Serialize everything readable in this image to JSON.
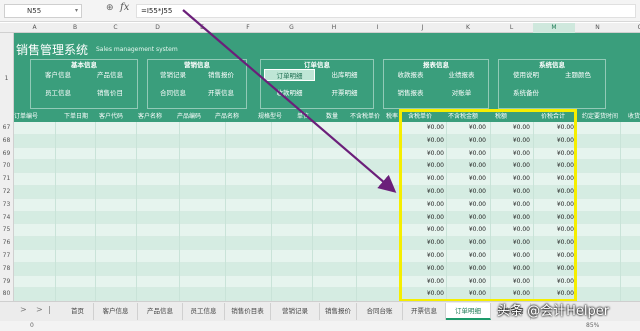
{
  "formula_bar": {
    "name_box": "N55",
    "fx_label": "fx",
    "formula": "=I55*J55"
  },
  "columns": [
    "A",
    "B",
    "C",
    "D",
    "E",
    "F",
    "G",
    "H",
    "I",
    "J",
    "K",
    "L",
    "M",
    "N",
    "O"
  ],
  "banner": {
    "title": "销售管理系统",
    "subtitle": "Sales management system",
    "row_label": "1",
    "groups": [
      {
        "title": "基本信息",
        "buttons": [
          "客户信息",
          "产品信息",
          "员工信息",
          "销售价目"
        ]
      },
      {
        "title": "营销信息",
        "buttons": [
          "营销记录",
          "销售报价",
          "合同信息",
          "开票信息"
        ]
      },
      {
        "title": "订单信息",
        "buttons": [
          "订单明细",
          "出库明细",
          "收款明细",
          "开票明细"
        ]
      },
      {
        "title": "报表信息",
        "buttons": [
          "收款报表",
          "业绩报表",
          "销售报表",
          "对账单"
        ]
      },
      {
        "title": "系统信息",
        "buttons": [
          "使用说明",
          "主题颜色",
          "系统备份"
        ]
      }
    ]
  },
  "table_header": [
    "订单编号",
    "下单日期",
    "客户代码",
    "客户名称",
    "产品编码",
    "产品名称",
    "规格型号",
    "单位",
    "数量",
    "不含税单价",
    "税率",
    "含税单价",
    "不含税金额",
    "税额",
    "价税合计",
    "约定要货时间",
    "收货"
  ],
  "rows": [
    {
      "num": "67",
      "values": [
        "¥0.00",
        "¥0.00",
        "¥0.00",
        "¥0.00"
      ]
    },
    {
      "num": "68",
      "values": [
        "¥0.00",
        "¥0.00",
        "¥0.00",
        "¥0.00"
      ]
    },
    {
      "num": "69",
      "values": [
        "¥0.00",
        "¥0.00",
        "¥0.00",
        "¥0.00"
      ]
    },
    {
      "num": "70",
      "values": [
        "¥0.00",
        "¥0.00",
        "¥0.00",
        "¥0.00"
      ]
    },
    {
      "num": "71",
      "values": [
        "¥0.00",
        "¥0.00",
        "¥0.00",
        "¥0.00"
      ]
    },
    {
      "num": "72",
      "values": [
        "¥0.00",
        "¥0.00",
        "¥0.00",
        "¥0.00"
      ]
    },
    {
      "num": "73",
      "values": [
        "¥0.00",
        "¥0.00",
        "¥0.00",
        "¥0.00"
      ]
    },
    {
      "num": "74",
      "values": [
        "¥0.00",
        "¥0.00",
        "¥0.00",
        "¥0.00"
      ]
    },
    {
      "num": "75",
      "values": [
        "¥0.00",
        "¥0.00",
        "¥0.00",
        "¥0.00"
      ]
    },
    {
      "num": "76",
      "values": [
        "¥0.00",
        "¥0.00",
        "¥0.00",
        "¥0.00"
      ]
    },
    {
      "num": "77",
      "values": [
        "¥0.00",
        "¥0.00",
        "¥0.00",
        "¥0.00"
      ]
    },
    {
      "num": "78",
      "values": [
        "¥0.00",
        "¥0.00",
        "¥0.00",
        "¥0.00"
      ]
    },
    {
      "num": "79",
      "values": [
        "¥0.00",
        "¥0.00",
        "¥0.00",
        "¥0.00"
      ]
    },
    {
      "num": "80",
      "values": [
        "¥0.00",
        "¥0.00",
        "¥0.00",
        "¥0.00"
      ]
    }
  ],
  "sheet_tabs": [
    "首页",
    "客户信息",
    "产品信息",
    "员工信息",
    "销售价目表",
    "营销记录",
    "销售报价",
    "合同台账",
    "开票信息",
    "订单明细",
    "出库明细"
  ],
  "active_tab": "订单明细",
  "status": {
    "left": "0",
    "zoom": "85%"
  },
  "watermark": "头条 @会计Helper",
  "colors": {
    "banner": "#3a9e7c",
    "highlight": "#f5ee00",
    "arrow": "#6b1f7a"
  }
}
